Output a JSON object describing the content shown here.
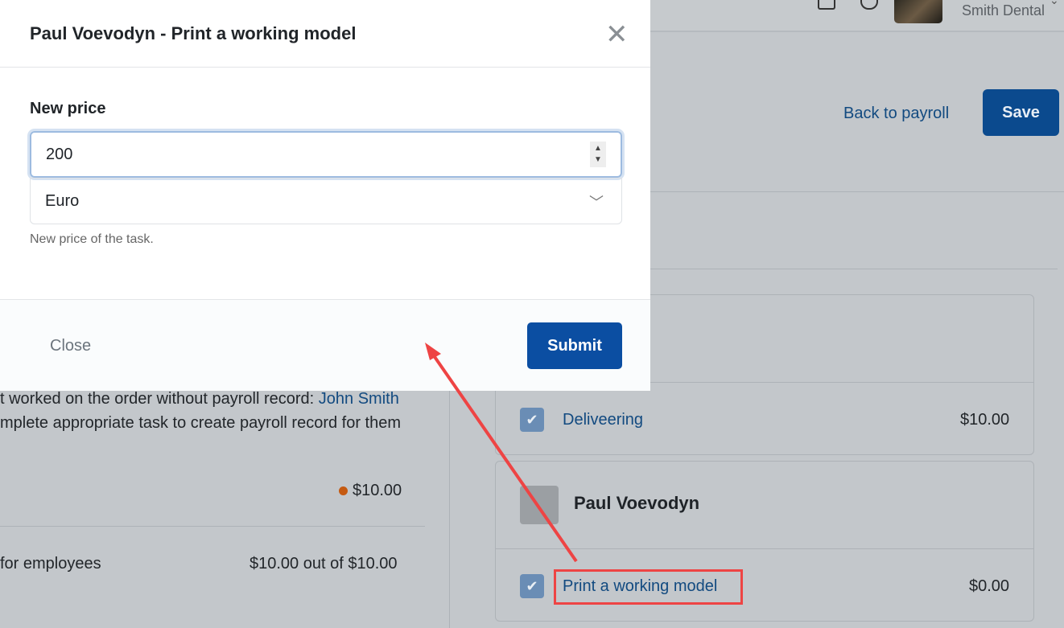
{
  "header": {
    "company": "Smith Dental",
    "icons": [
      "export-icon",
      "bell-icon",
      "avatar",
      "chevron-down-icon"
    ]
  },
  "page": {
    "back_label": "Back to payroll",
    "save_label": "Save",
    "warning_line1": "t worked on the order without payroll record: ",
    "warning_name": "John Smith",
    "warning_line2": "mplete appropriate task to create payroll record for them",
    "total_amount": "$10.00",
    "status_color": "#c55a11",
    "employees_label": "for employees",
    "employees_amount": "$10.00 out of $10.00"
  },
  "assignees": [
    {
      "tasks": [
        {
          "name": "Deliveering",
          "price": "$10.00",
          "checked": true
        }
      ]
    },
    {
      "name": "Paul Voevodyn",
      "tasks": [
        {
          "name": "Print a working model",
          "price": "$0.00",
          "checked": true
        }
      ]
    }
  ],
  "modal": {
    "title": "Paul Voevodyn - Print a working model",
    "field_label": "New price",
    "value": "200",
    "currency": "Euro",
    "help": "New price of the task.",
    "close_label": "Close",
    "submit_label": "Submit"
  },
  "annotation": {
    "color": "#ee4444"
  }
}
